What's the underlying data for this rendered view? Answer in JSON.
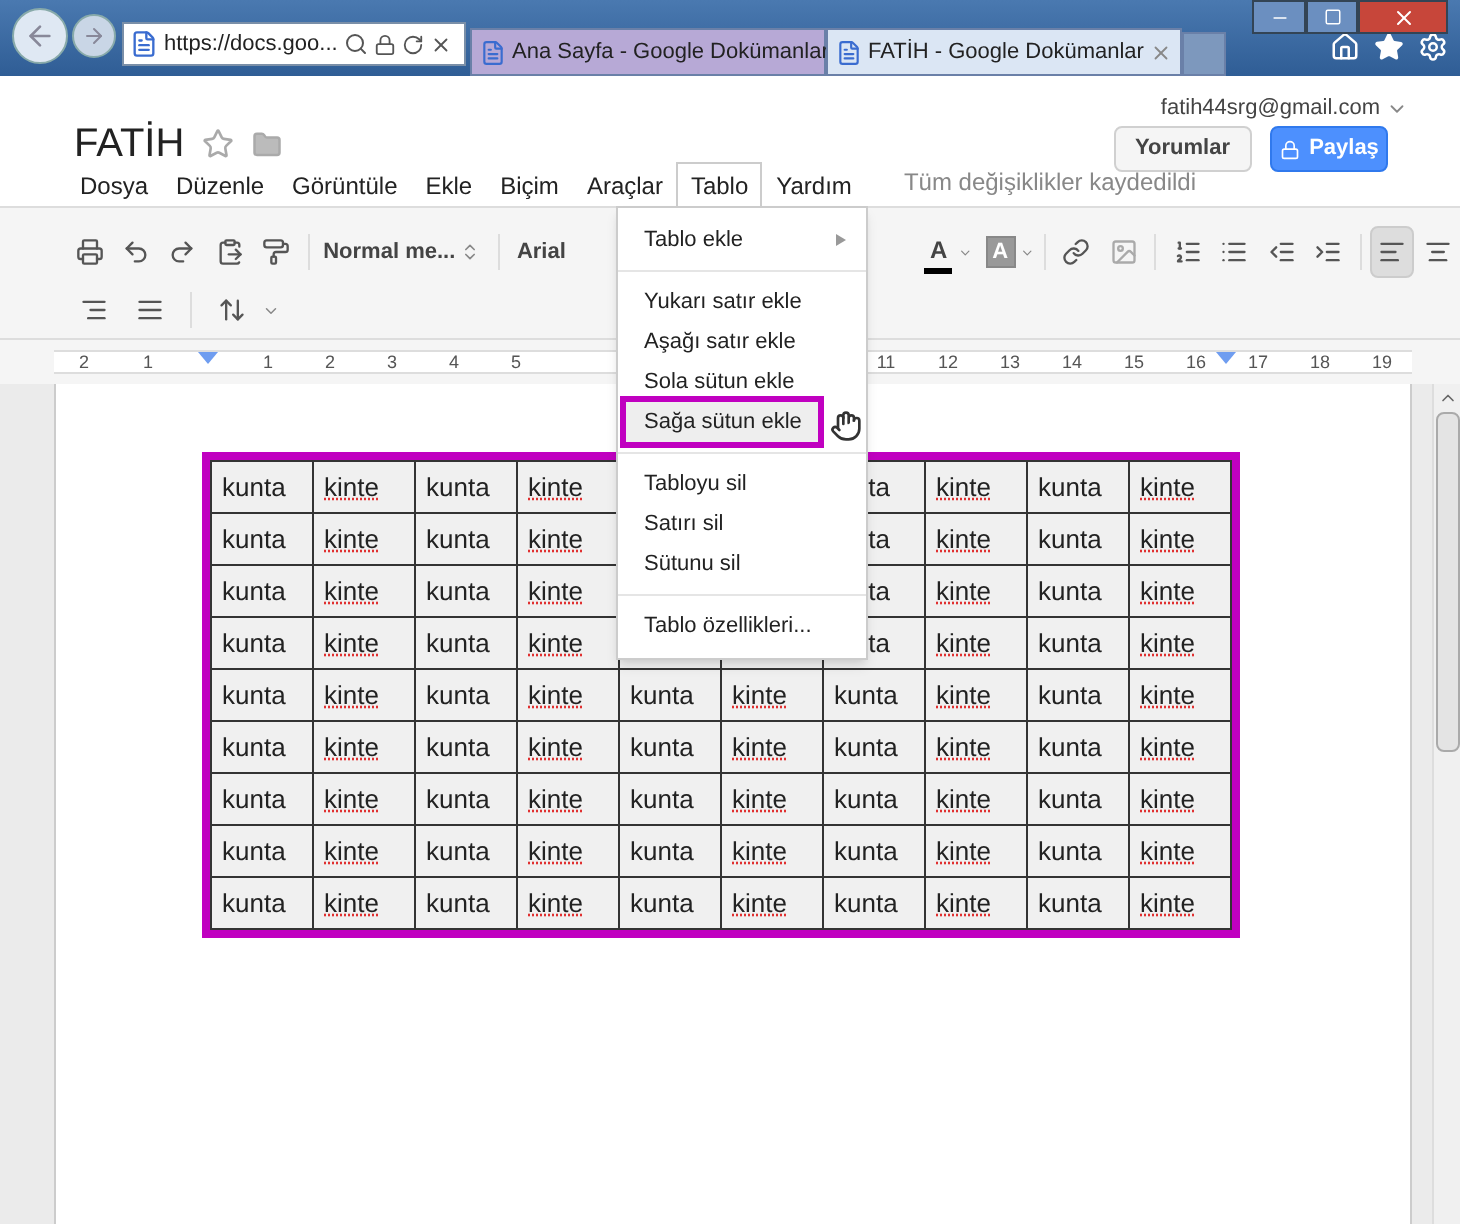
{
  "browser": {
    "address": "https://docs.goo...",
    "tabs": [
      {
        "title": "Ana Sayfa - Google Dokümanlar",
        "selected": false
      },
      {
        "title": "FATİH - Google Dokümanlar",
        "selected": true
      }
    ]
  },
  "header": {
    "account": "fatih44srg@gmail.com",
    "title": "FATİH",
    "starred": false,
    "comments_button": "Yorumlar",
    "share_button": "Paylaş",
    "save_status": "Tüm değişiklikler kaydedildi"
  },
  "menus": [
    {
      "label": "Dosya",
      "selected": false
    },
    {
      "label": "Düzenle",
      "selected": false
    },
    {
      "label": "Görüntüle",
      "selected": false
    },
    {
      "label": "Ekle",
      "selected": false
    },
    {
      "label": "Biçim",
      "selected": false
    },
    {
      "label": "Araçlar",
      "selected": false
    },
    {
      "label": "Tablo",
      "selected": true
    },
    {
      "label": "Yardım",
      "selected": false
    }
  ],
  "toolbar": {
    "style": "Normal me...",
    "font": "Arial",
    "text_color_glyph": "A",
    "highlight_glyph": "A",
    "align_row1": [
      {
        "kind": "left",
        "selected": true
      },
      {
        "kind": "center",
        "selected": false
      }
    ],
    "align_row2": [
      {
        "kind": "right",
        "selected": false
      },
      {
        "kind": "justify",
        "selected": false
      }
    ]
  },
  "ruler": [
    "2",
    "1",
    "1",
    "2",
    "3",
    "4",
    "5",
    "11",
    "12",
    "13",
    "14",
    "15",
    "16",
    "17",
    "18",
    "19"
  ],
  "dropdown": [
    {
      "kind": "item",
      "label": "Tablo ekle",
      "submenu": true,
      "highlighted": false
    },
    {
      "kind": "divider"
    },
    {
      "kind": "item",
      "label": "Yukarı satır ekle",
      "submenu": false,
      "highlighted": false
    },
    {
      "kind": "item",
      "label": "Aşağı satır ekle",
      "submenu": false,
      "highlighted": false
    },
    {
      "kind": "item",
      "label": "Sola sütun ekle",
      "submenu": false,
      "highlighted": false
    },
    {
      "kind": "item",
      "label": "Sağa sütun ekle",
      "submenu": false,
      "highlighted": true
    },
    {
      "kind": "divider"
    },
    {
      "kind": "item",
      "label": "Tabloyu sil",
      "submenu": false,
      "highlighted": false
    },
    {
      "kind": "item",
      "label": "Satırı sil",
      "submenu": false,
      "highlighted": false
    },
    {
      "kind": "item",
      "label": "Sütunu sil",
      "submenu": false,
      "highlighted": false
    },
    {
      "kind": "divider"
    },
    {
      "kind": "item",
      "label": "Tablo özellikleri...",
      "submenu": false,
      "highlighted": false
    }
  ],
  "table": {
    "selected": true,
    "rows": [
      [
        {
          "text": "kunta",
          "misspelled": false
        },
        {
          "text": "kinte",
          "misspelled": true
        },
        {
          "text": "kunta",
          "misspelled": false
        },
        {
          "text": "kinte",
          "misspelled": true
        },
        null,
        null,
        {
          "text": "ta",
          "misspelled": false,
          "cut": true
        },
        {
          "text": "kinte",
          "misspelled": true
        },
        {
          "text": "kunta",
          "misspelled": false
        },
        {
          "text": "kinte",
          "misspelled": true
        }
      ],
      [
        {
          "text": "kunta",
          "misspelled": false
        },
        {
          "text": "kinte",
          "misspelled": true
        },
        {
          "text": "kunta",
          "misspelled": false
        },
        {
          "text": "kinte",
          "misspelled": true
        },
        null,
        null,
        {
          "text": "ta",
          "misspelled": false,
          "cut": true
        },
        {
          "text": "kinte",
          "misspelled": true
        },
        {
          "text": "kunta",
          "misspelled": false
        },
        {
          "text": "kinte",
          "misspelled": true
        }
      ],
      [
        {
          "text": "kunta",
          "misspelled": false
        },
        {
          "text": "kinte",
          "misspelled": true
        },
        {
          "text": "kunta",
          "misspelled": false
        },
        {
          "text": "kinte",
          "misspelled": true
        },
        null,
        null,
        {
          "text": "ta",
          "misspelled": false,
          "cut": true
        },
        {
          "text": "kinte",
          "misspelled": true
        },
        {
          "text": "kunta",
          "misspelled": false
        },
        {
          "text": "kinte",
          "misspelled": true
        }
      ],
      [
        {
          "text": "kunta",
          "misspelled": false
        },
        {
          "text": "kinte",
          "misspelled": true
        },
        {
          "text": "kunta",
          "misspelled": false
        },
        {
          "text": "kinte",
          "misspelled": true
        },
        null,
        null,
        {
          "text": "ta",
          "misspelled": false,
          "cut": true
        },
        {
          "text": "kinte",
          "misspelled": true
        },
        {
          "text": "kunta",
          "misspelled": false
        },
        {
          "text": "kinte",
          "misspelled": true
        }
      ],
      [
        {
          "text": "kunta",
          "misspelled": false
        },
        {
          "text": "kinte",
          "misspelled": true
        },
        {
          "text": "kunta",
          "misspelled": false
        },
        {
          "text": "kinte",
          "misspelled": true
        },
        {
          "text": "kunta",
          "misspelled": false
        },
        {
          "text": "kinte",
          "misspelled": true
        },
        {
          "text": "kunta",
          "misspelled": false
        },
        {
          "text": "kinte",
          "misspelled": true
        },
        {
          "text": "kunta",
          "misspelled": false
        },
        {
          "text": "kinte",
          "misspelled": true
        }
      ],
      [
        {
          "text": "kunta",
          "misspelled": false
        },
        {
          "text": "kinte",
          "misspelled": true
        },
        {
          "text": "kunta",
          "misspelled": false
        },
        {
          "text": "kinte",
          "misspelled": true
        },
        {
          "text": "kunta",
          "misspelled": false
        },
        {
          "text": "kinte",
          "misspelled": true
        },
        {
          "text": "kunta",
          "misspelled": false
        },
        {
          "text": "kinte",
          "misspelled": true
        },
        {
          "text": "kunta",
          "misspelled": false
        },
        {
          "text": "kinte",
          "misspelled": true
        }
      ],
      [
        {
          "text": "kunta",
          "misspelled": false
        },
        {
          "text": "kinte",
          "misspelled": true
        },
        {
          "text": "kunta",
          "misspelled": false
        },
        {
          "text": "kinte",
          "misspelled": true
        },
        {
          "text": "kunta",
          "misspelled": false
        },
        {
          "text": "kinte",
          "misspelled": true
        },
        {
          "text": "kunta",
          "misspelled": false
        },
        {
          "text": "kinte",
          "misspelled": true
        },
        {
          "text": "kunta",
          "misspelled": false
        },
        {
          "text": "kinte",
          "misspelled": true
        }
      ],
      [
        {
          "text": "kunta",
          "misspelled": false
        },
        {
          "text": "kinte",
          "misspelled": true
        },
        {
          "text": "kunta",
          "misspelled": false
        },
        {
          "text": "kinte",
          "misspelled": true
        },
        {
          "text": "kunta",
          "misspelled": false
        },
        {
          "text": "kinte",
          "misspelled": true
        },
        {
          "text": "kunta",
          "misspelled": false
        },
        {
          "text": "kinte",
          "misspelled": true
        },
        {
          "text": "kunta",
          "misspelled": false
        },
        {
          "text": "kinte",
          "misspelled": true
        }
      ],
      [
        {
          "text": "kunta",
          "misspelled": false
        },
        {
          "text": "kinte",
          "misspelled": true
        },
        {
          "text": "kunta",
          "misspelled": false
        },
        {
          "text": "kinte",
          "misspelled": true
        },
        {
          "text": "kunta",
          "misspelled": false
        },
        {
          "text": "kinte",
          "misspelled": true
        },
        {
          "text": "kunta",
          "misspelled": false
        },
        {
          "text": "kinte",
          "misspelled": true
        },
        {
          "text": "kunta",
          "misspelled": false
        },
        {
          "text": "kinte",
          "misspelled": true
        }
      ]
    ]
  }
}
